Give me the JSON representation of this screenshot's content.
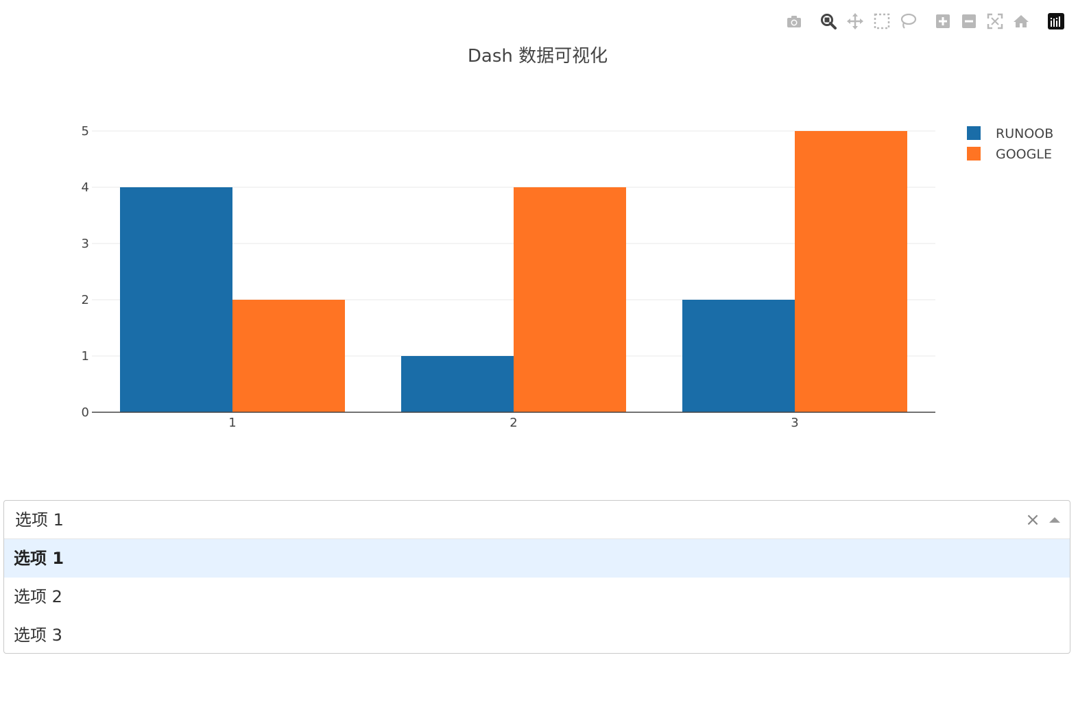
{
  "modebar": {
    "buttons": [
      {
        "icon": "camera-icon",
        "name": "download-plot-button"
      },
      {
        "icon": "zoom-icon",
        "name": "zoom-button"
      },
      {
        "icon": "pan-icon",
        "name": "pan-button"
      },
      {
        "icon": "box-select-icon",
        "name": "box-select-button"
      },
      {
        "icon": "lasso-select-icon",
        "name": "lasso-select-button"
      },
      {
        "icon": "zoom-in-icon",
        "name": "zoom-in-button"
      },
      {
        "icon": "zoom-out-icon",
        "name": "zoom-out-button"
      },
      {
        "icon": "autoscale-icon",
        "name": "autoscale-button"
      },
      {
        "icon": "home-icon",
        "name": "reset-axes-button"
      },
      {
        "icon": "plotly-logo-icon",
        "name": "plotly-logo-link"
      }
    ]
  },
  "chart_data": {
    "type": "bar",
    "title": "Dash 数据可视化",
    "categories": [
      "1",
      "2",
      "3"
    ],
    "series": [
      {
        "name": "RUNOOB",
        "values": [
          4,
          1,
          2
        ],
        "color": "#1a6da8"
      },
      {
        "name": "GOOGLE",
        "values": [
          2,
          4,
          5
        ],
        "color": "#ff7423"
      }
    ],
    "xlabel": "",
    "ylabel": "",
    "ylim": [
      0,
      5
    ],
    "yticks": [
      "0",
      "1",
      "2",
      "3",
      "4",
      "5"
    ],
    "grid": true,
    "legend_position": "top-right"
  },
  "dropdown": {
    "selected_value": "选项 1",
    "clear_glyph": "×",
    "options": [
      {
        "label": "选项 1",
        "selected": true
      },
      {
        "label": "选项 2",
        "selected": false
      },
      {
        "label": "选项 3",
        "selected": false
      }
    ]
  }
}
